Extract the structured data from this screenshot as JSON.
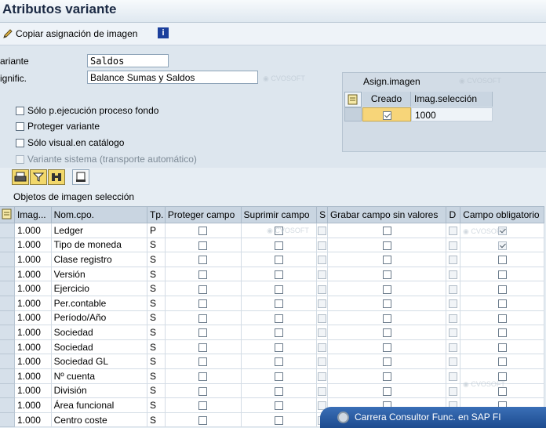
{
  "window": {
    "title": "Atributos variante"
  },
  "toolbar": {
    "copy_label": "Copiar asignación de imagen",
    "info_glyph": "i"
  },
  "form": {
    "variant_label": "ariante",
    "variant_value": "Saldos",
    "meaning_label": "ignific.",
    "meaning_value": "Balance Sumas y Saldos"
  },
  "options": [
    {
      "label": "Sólo p.ejecución proceso fondo",
      "checked": false,
      "disabled": false
    },
    {
      "label": "Proteger variante",
      "checked": false,
      "disabled": false
    },
    {
      "label": "Sólo visual.en catálogo",
      "checked": false,
      "disabled": false
    },
    {
      "label": "Variante sistema (transporte automático)",
      "checked": false,
      "disabled": true
    }
  ],
  "assign": {
    "title": "Asign.imagen",
    "col_created": "Creado",
    "col_selection": "Imag.selección",
    "row_created_checked": true,
    "row_selection": "1000"
  },
  "section": {
    "title": "Objetos de imagen selección"
  },
  "grid": {
    "headers": [
      "Imag...",
      "Nom.cpo.",
      "Tp.",
      "Proteger campo",
      "Suprimir campo",
      "S",
      "Grabar campo sin valores",
      "D",
      "Campo obligatorio"
    ],
    "rows": [
      {
        "imag": "1.000",
        "name": "Ledger",
        "tp": "P",
        "required": true
      },
      {
        "imag": "1.000",
        "name": "Tipo de moneda",
        "tp": "S",
        "required": true
      },
      {
        "imag": "1.000",
        "name": "Clase registro",
        "tp": "S",
        "required": false
      },
      {
        "imag": "1.000",
        "name": "Versión",
        "tp": "S",
        "required": false
      },
      {
        "imag": "1.000",
        "name": "Ejercicio",
        "tp": "S",
        "required": false
      },
      {
        "imag": "1.000",
        "name": "Per.contable",
        "tp": "S",
        "required": false
      },
      {
        "imag": "1.000",
        "name": "Período/Año",
        "tp": "S",
        "required": false
      },
      {
        "imag": "1.000",
        "name": "Sociedad",
        "tp": "S",
        "required": false
      },
      {
        "imag": "1.000",
        "name": "Sociedad",
        "tp": "S",
        "required": false
      },
      {
        "imag": "1.000",
        "name": "Sociedad GL",
        "tp": "S",
        "required": false
      },
      {
        "imag": "1.000",
        "name": "Nº cuenta",
        "tp": "S",
        "required": false
      },
      {
        "imag": "1.000",
        "name": "División",
        "tp": "S",
        "required": false
      },
      {
        "imag": "1.000",
        "name": "Área funcional",
        "tp": "S",
        "required": false
      },
      {
        "imag": "1.000",
        "name": "Centro coste",
        "tp": "S",
        "required": false
      }
    ]
  },
  "banner": {
    "text": "Carrera Consultor Func. en SAP FI"
  },
  "colors": {
    "title": "#1b2a44",
    "banner": "#1d4b8f",
    "button_yellow": "#f2d86b"
  }
}
